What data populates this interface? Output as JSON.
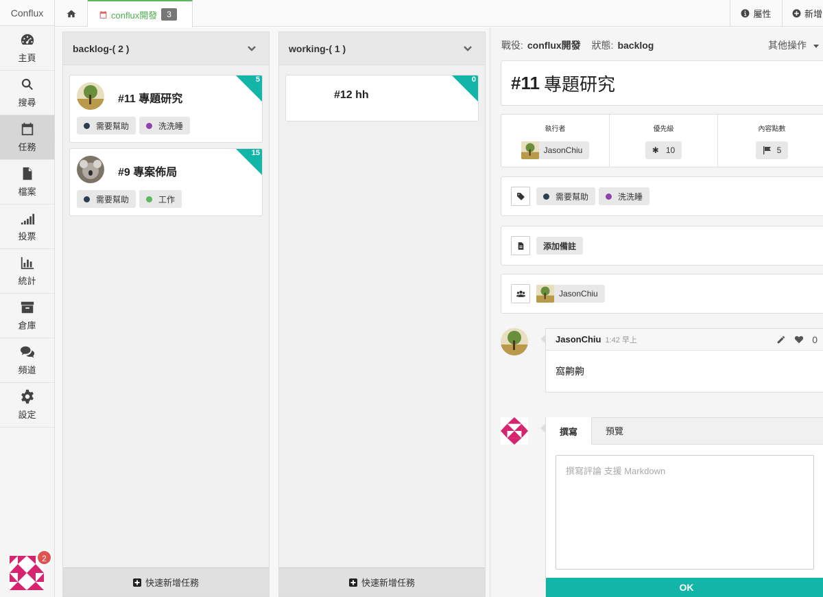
{
  "brand": "Conflux",
  "sidebar": {
    "items": [
      {
        "label": "主頁",
        "icon": "dashboard-icon"
      },
      {
        "label": "搜尋",
        "icon": "search-icon"
      },
      {
        "label": "任務",
        "icon": "calendar-icon",
        "active": true
      },
      {
        "label": "檔案",
        "icon": "file-icon"
      },
      {
        "label": "投票",
        "icon": "signal-icon"
      },
      {
        "label": "統計",
        "icon": "bar-chart-icon"
      },
      {
        "label": "倉庫",
        "icon": "archive-icon"
      },
      {
        "label": "頻道",
        "icon": "comments-icon"
      },
      {
        "label": "設定",
        "icon": "gear-icon"
      }
    ],
    "notification_count": "2"
  },
  "topbar": {
    "project_tab": "conflux開發",
    "project_count": "3",
    "properties_label": "屬性",
    "new_label": "新增"
  },
  "board": {
    "columns": [
      {
        "title": "backlog-( 2 )",
        "cards": [
          {
            "title": "#11 專題研究",
            "points": "5",
            "tags": [
              {
                "label": "需要幫助",
                "color": "#2c3e50"
              },
              {
                "label": "洗洗睡",
                "color": "#8e44ad"
              }
            ]
          },
          {
            "title": "#9 專案佈局",
            "points": "15",
            "tags": [
              {
                "label": "需要幫助",
                "color": "#2c3e50"
              },
              {
                "label": "工作",
                "color": "#5cb85c"
              }
            ]
          }
        ],
        "footer": "快速新增任務"
      },
      {
        "title": "working-( 1 )",
        "cards": [
          {
            "title": "#12 hh",
            "points": "0",
            "tags": []
          }
        ],
        "footer": "快速新增任務"
      }
    ]
  },
  "detail": {
    "project_label": "戰役:",
    "project_value": "conflux開發",
    "status_label": "狀態:",
    "status_value": "backlog",
    "other_ops": "其他操作",
    "task_number": "#11",
    "task_title": "專題研究",
    "meta": {
      "assignee_label": "執行者",
      "assignee": "JasonChiu",
      "priority_label": "優先級",
      "priority": "10",
      "points_label": "內容點數",
      "points": "5"
    },
    "tags": [
      {
        "label": "需要幫助",
        "color": "#2c3e50"
      },
      {
        "label": "洗洗睡",
        "color": "#8e44ad"
      }
    ],
    "add_note": "添加備註",
    "member": "JasonChiu",
    "comment": {
      "author": "JasonChiu",
      "time": "1:42 早上",
      "likes": "0",
      "body": "窩齁齁"
    },
    "editor": {
      "tab_write": "撰寫",
      "tab_preview": "預覽",
      "placeholder": "撰寫評論 支援 Markdown",
      "ok": "OK"
    }
  },
  "colors": {
    "accent": "#13b5a8",
    "tab_green": "#4cae4c",
    "badge_red": "#e05252"
  }
}
